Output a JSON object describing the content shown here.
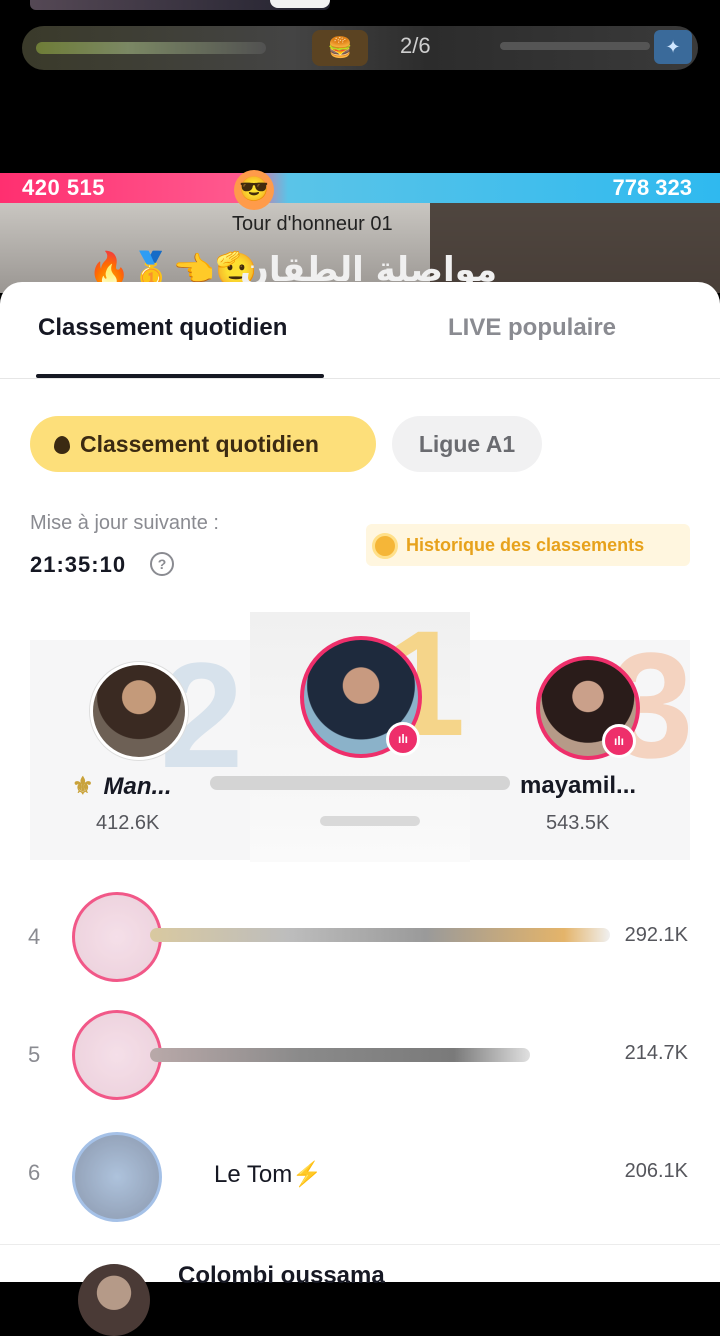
{
  "live": {
    "round_counter": "2/6",
    "left_score": "420 515",
    "right_score": "778 323",
    "subtitle": "Tour d'honneur 01",
    "emojis": "🔥🥇👈🫡",
    "arabic_name": "مواصلة الطقان"
  },
  "tabs": [
    {
      "label": "Classement quotidien",
      "active": true
    },
    {
      "label": "LIVE populaire",
      "active": false
    }
  ],
  "filters": [
    {
      "label": "Classement quotidien",
      "active": true
    },
    {
      "label": "Ligue A1",
      "active": false
    }
  ],
  "update": {
    "label": "Mise à jour suivante :",
    "countdown": "21:35:10"
  },
  "history_link": "Historique des classements",
  "podium": [
    {
      "rank": "2",
      "name": "Man...",
      "prefix": "⚜",
      "score": "412.6K",
      "live": false
    },
    {
      "rank": "1",
      "name": "",
      "score": "",
      "live": true
    },
    {
      "rank": "3",
      "name": "mayamil...",
      "score": "543.5K",
      "live": true
    }
  ],
  "list": [
    {
      "rank": "4",
      "name": "",
      "score": "292.1K"
    },
    {
      "rank": "5",
      "name": "",
      "score": "214.7K"
    },
    {
      "rank": "6",
      "name": "Le Tom",
      "badge": "⚡",
      "score": "206.1K"
    }
  ],
  "next_item": {
    "name": "Colombi oussama"
  },
  "colors": {
    "accent": "#ee2f6b",
    "pill_active": "#fddf7a",
    "history": "#e7a21c"
  }
}
